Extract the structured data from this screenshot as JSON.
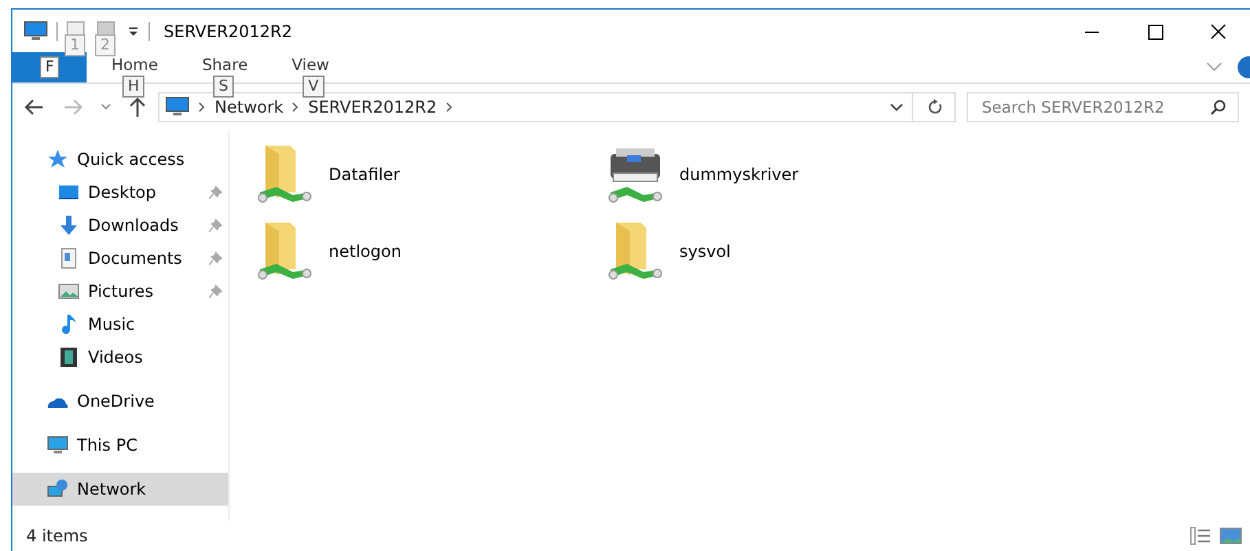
{
  "window": {
    "title": "SERVER2012R2"
  },
  "quick_access_keytips": [
    "1",
    "2"
  ],
  "ribbon_tabs": [
    {
      "keytip": "F",
      "kind": "file"
    },
    {
      "label": "Home",
      "keytip": "H",
      "kind": "tab"
    },
    {
      "label": "Share",
      "keytip": "S",
      "kind": "tab"
    },
    {
      "label": "View",
      "keytip": "V",
      "kind": "tab"
    }
  ],
  "address_bar": {
    "path": [
      "Network",
      "SERVER2012R2"
    ]
  },
  "search": {
    "placeholder": "Search SERVER2012R2"
  },
  "sidebar": {
    "items": [
      {
        "label": "Quick access",
        "kind": "star",
        "selected": false,
        "children": [
          {
            "label": "Desktop",
            "kind": "desktop",
            "pinned": true,
            "selected": false
          },
          {
            "label": "Downloads",
            "kind": "download",
            "pinned": true,
            "selected": false
          },
          {
            "label": "Documents",
            "kind": "document",
            "pinned": true,
            "selected": false
          },
          {
            "label": "Pictures",
            "kind": "pictures",
            "pinned": true,
            "selected": false
          },
          {
            "label": "Music",
            "kind": "music",
            "pinned": false,
            "selected": false
          },
          {
            "label": "Videos",
            "kind": "videos",
            "pinned": false,
            "selected": false
          }
        ]
      },
      {
        "label": "OneDrive",
        "kind": "cloud",
        "selected": false
      },
      {
        "label": "This PC",
        "kind": "pc",
        "selected": false
      },
      {
        "label": "Network",
        "kind": "network",
        "selected": true
      }
    ]
  },
  "items": [
    {
      "name": "Datafiler",
      "kind": "share"
    },
    {
      "name": "dummyskriver",
      "kind": "printer"
    },
    {
      "name": "netlogon",
      "kind": "share"
    },
    {
      "name": "sysvol",
      "kind": "share"
    }
  ],
  "status_bar": {
    "count": "4 items"
  }
}
